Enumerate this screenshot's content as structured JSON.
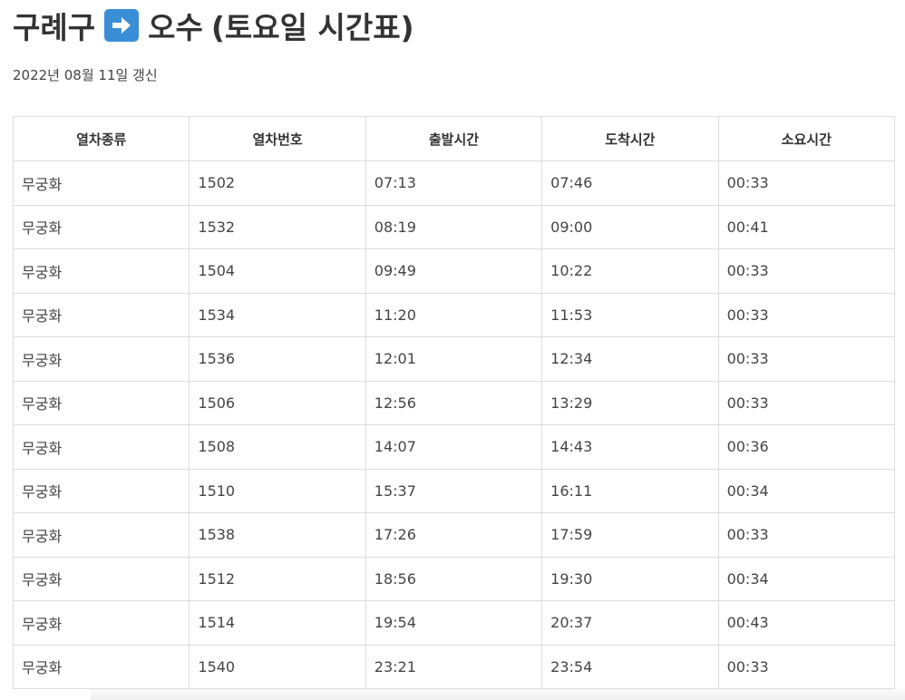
{
  "title": {
    "origin": "구례구",
    "arrow_icon": "right-arrow-icon",
    "destination": "오수",
    "schedule_type": "(토요일 시간표)"
  },
  "updated_text": "2022년 08월 11일 갱신",
  "colors": {
    "arrow_icon_bg": "#3a8ed6",
    "border": "#dcdcdc",
    "text": "#333333"
  },
  "table": {
    "headers": [
      "열차종류",
      "열차번호",
      "출발시간",
      "도착시간",
      "소요시간"
    ],
    "rows": [
      [
        "무궁화",
        "1502",
        "07:13",
        "07:46",
        "00:33"
      ],
      [
        "무궁화",
        "1532",
        "08:19",
        "09:00",
        "00:41"
      ],
      [
        "무궁화",
        "1504",
        "09:49",
        "10:22",
        "00:33"
      ],
      [
        "무궁화",
        "1534",
        "11:20",
        "11:53",
        "00:33"
      ],
      [
        "무궁화",
        "1536",
        "12:01",
        "12:34",
        "00:33"
      ],
      [
        "무궁화",
        "1506",
        "12:56",
        "13:29",
        "00:33"
      ],
      [
        "무궁화",
        "1508",
        "14:07",
        "14:43",
        "00:36"
      ],
      [
        "무궁화",
        "1510",
        "15:37",
        "16:11",
        "00:34"
      ],
      [
        "무궁화",
        "1538",
        "17:26",
        "17:59",
        "00:33"
      ],
      [
        "무궁화",
        "1512",
        "18:56",
        "19:30",
        "00:34"
      ],
      [
        "무궁화",
        "1514",
        "19:54",
        "20:37",
        "00:43"
      ],
      [
        "무궁화",
        "1540",
        "23:21",
        "23:54",
        "00:33"
      ]
    ]
  }
}
